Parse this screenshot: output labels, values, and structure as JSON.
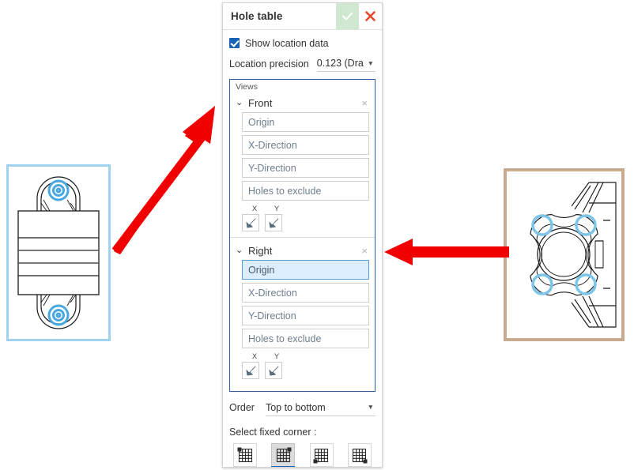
{
  "dialog": {
    "title": "Hole table",
    "accept_icon": "check-icon",
    "reject_icon": "close-icon",
    "show_location_data": {
      "label": "Show location data",
      "checked": true
    },
    "location_precision": {
      "label": "Location precision",
      "value": "0.123 (Dra",
      "caret": "▼"
    },
    "views_panel": {
      "caption": "Views",
      "views": [
        {
          "name": "Front",
          "chevron": "⌄",
          "close": "×",
          "expanded": true,
          "fields": [
            {
              "placeholder": "Origin",
              "focused": false
            },
            {
              "placeholder": "X-Direction",
              "focused": false
            },
            {
              "placeholder": "Y-Direction",
              "focused": false
            },
            {
              "placeholder": "Holes to exclude",
              "focused": false
            }
          ],
          "pickers": [
            {
              "label": "X",
              "icon": "pick-direction-icon"
            },
            {
              "label": "Y",
              "icon": "pick-direction-icon"
            }
          ]
        },
        {
          "name": "Right",
          "chevron": "⌄",
          "close": "×",
          "expanded": true,
          "fields": [
            {
              "placeholder": "Origin",
              "focused": true
            },
            {
              "placeholder": "X-Direction",
              "focused": false
            },
            {
              "placeholder": "Y-Direction",
              "focused": false
            },
            {
              "placeholder": "Holes to exclude",
              "focused": false
            }
          ],
          "pickers": [
            {
              "label": "X",
              "icon": "pick-direction-icon"
            },
            {
              "label": "Y",
              "icon": "pick-direction-icon"
            }
          ]
        }
      ]
    },
    "order": {
      "label": "Order",
      "value": "Top to bottom",
      "caret": "▼"
    },
    "fixed_corner": {
      "label": "Select fixed corner :",
      "options": [
        {
          "name": "corner-top-left",
          "selected": false
        },
        {
          "name": "corner-top-right",
          "selected": true
        },
        {
          "name": "corner-bottom-left",
          "selected": false
        },
        {
          "name": "corner-bottom-right",
          "selected": false
        }
      ]
    }
  },
  "drawings": {
    "front_view": {
      "name": "front-view-drawing",
      "frame_color": "#9fd2ef",
      "hole_marker_color": "#4aa8e0",
      "hole_count": 2
    },
    "right_view": {
      "name": "right-view-drawing",
      "frame_color": "#c8ab8e",
      "hole_marker_color": "#7cc4e8",
      "hole_count": 4
    }
  },
  "annotations": {
    "arrow_to_front_view": {
      "name": "red-arrow-to-front-view",
      "color": "#f00000",
      "direction": "up-right"
    },
    "arrow_to_right_view": {
      "name": "red-arrow-to-right-view",
      "color": "#f00000",
      "direction": "left"
    }
  }
}
